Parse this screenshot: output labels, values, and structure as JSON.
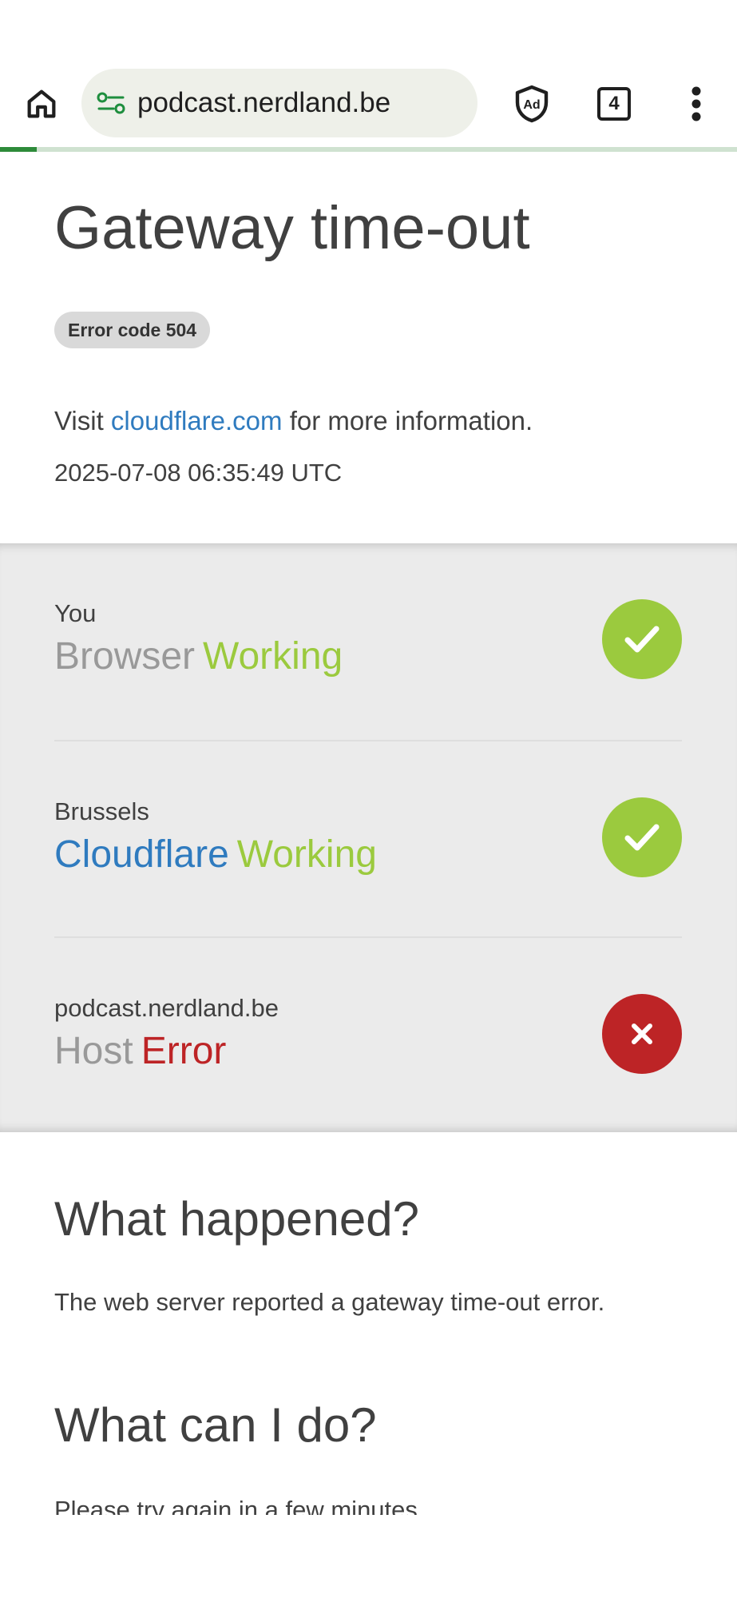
{
  "browser": {
    "url": "podcast.nerdland.be",
    "tab_count": "4",
    "progress": 0.05,
    "accent_color": "#2e8b3a",
    "icons": [
      "home-icon",
      "site-settings-icon",
      "adblock-shield-icon",
      "tabs-icon",
      "more-menu-icon"
    ]
  },
  "page": {
    "title": "Gateway time-out",
    "error_badge": "Error code 504",
    "visit_prefix": "Visit",
    "visit_link": "cloudflare.com",
    "visit_suffix": "for more information.",
    "timestamp": "2025-07-08 06:35:49 UTC"
  },
  "status": {
    "rows": [
      {
        "location": "You",
        "name": "Browser",
        "status": "Working",
        "state": "ok",
        "icon": "check-icon"
      },
      {
        "location": "Brussels",
        "name": "Cloudflare",
        "status": "Working",
        "state": "ok",
        "icon": "check-icon"
      },
      {
        "location": "podcast.nerdland.be",
        "name": "Host",
        "status": "Error",
        "state": "error",
        "icon": "cross-icon"
      }
    ],
    "colors": {
      "ok": "#9bca3e",
      "error": "#bd2426",
      "cloudflare": "#2f7bbf"
    }
  },
  "explanation": {
    "what_happened_heading": "What happened?",
    "what_happened_text": "The web server reported a gateway time-out error.",
    "what_can_i_do_heading": "What can I do?",
    "what_can_i_do_text": "Please try again in a few minutes."
  }
}
